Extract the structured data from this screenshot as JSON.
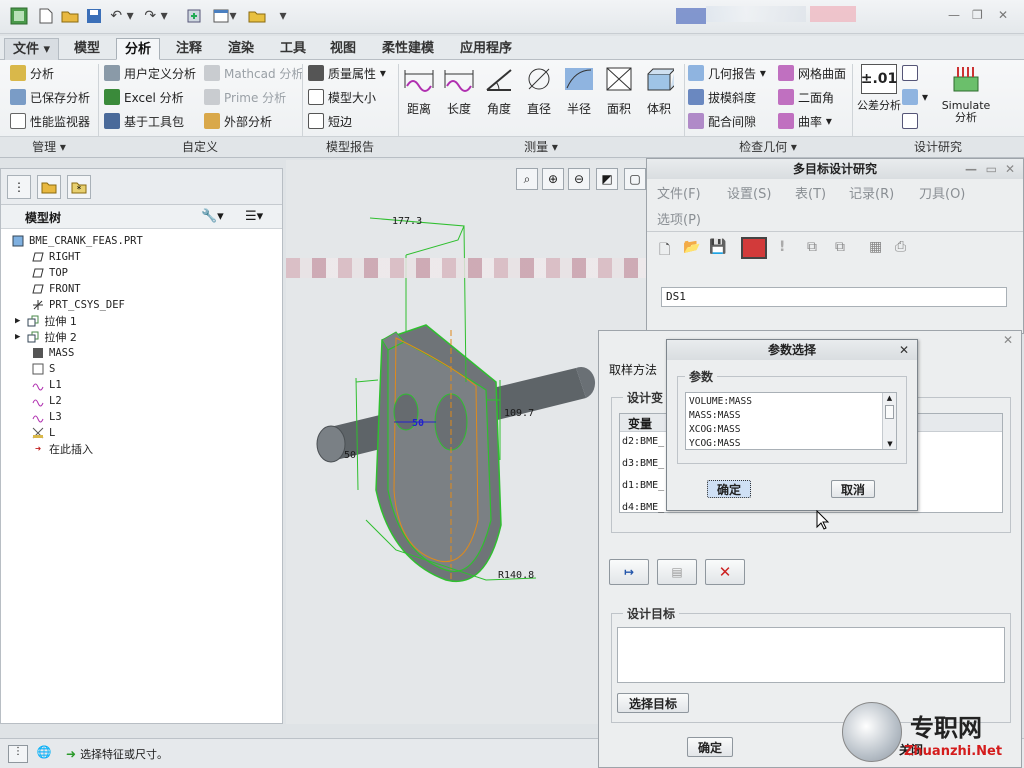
{
  "ribbon_tabs": {
    "file": "文件",
    "items": [
      "模型",
      "分析",
      "注释",
      "渲染",
      "工具",
      "视图",
      "柔性建模",
      "应用程序"
    ],
    "active": "分析"
  },
  "ribbon": {
    "manage": {
      "label": "管理",
      "items": [
        "分析",
        "已保存分析",
        "性能监视器"
      ]
    },
    "custom": {
      "label": "自定义",
      "items": [
        "用户定义分析",
        "Excel 分析",
        "基于工具包",
        "Mathcad 分析",
        "Prime 分析",
        "外部分析"
      ]
    },
    "model_report": {
      "label": "模型报告",
      "items": [
        "质量属性",
        "模型大小",
        "短边"
      ]
    },
    "measure": {
      "label": "测量",
      "items": [
        "距离",
        "长度",
        "角度",
        "直径",
        "半径",
        "面积",
        "体积"
      ]
    },
    "inspect": {
      "label": "检查几何",
      "items": [
        "几何报告",
        "拔模斜度",
        "配合间隙",
        "网格曲面",
        "二面角",
        "曲率"
      ]
    },
    "design_study": {
      "label": "设计研究",
      "items": [
        "公差分析",
        "Simulate 分析"
      ],
      "tol_value": "±.01"
    }
  },
  "model_tree": {
    "title": "模型树",
    "items": [
      {
        "label": "BME_CRANK_FEAS.PRT",
        "icon": "part-icon"
      },
      {
        "label": "RIGHT",
        "icon": "datum-plane-icon"
      },
      {
        "label": "TOP",
        "icon": "datum-plane-icon"
      },
      {
        "label": "FRONT",
        "icon": "datum-plane-icon"
      },
      {
        "label": "PRT_CSYS_DEF",
        "icon": "csys-icon"
      },
      {
        "label": "拉伸 1",
        "icon": "extrude-icon"
      },
      {
        "label": "拉伸 2",
        "icon": "extrude-icon"
      },
      {
        "label": "MASS",
        "icon": "analysis-icon"
      },
      {
        "label": "S",
        "icon": "analysis-icon"
      },
      {
        "label": "L1",
        "icon": "measure-icon"
      },
      {
        "label": "L2",
        "icon": "measure-icon"
      },
      {
        "label": "L3",
        "icon": "measure-icon"
      },
      {
        "label": "L",
        "icon": "analysis-icon"
      },
      {
        "label": "在此插入",
        "icon": "insert-arrow-icon"
      }
    ]
  },
  "dimensions": {
    "d1": "177.3",
    "d2": "50",
    "d3": "109.7",
    "d4": "R140.8",
    "d5": "50"
  },
  "status": {
    "message": "选择特征或尺寸。"
  },
  "mo_dialog": {
    "title": "多目标设计研究",
    "menus": [
      "文件(F)",
      "设置(S)",
      "表(T)",
      "记录(R)",
      "刀具(O)",
      "选项(P)"
    ],
    "study_name": "DS1"
  },
  "sampling_dialog": {
    "method_label": "取样方法",
    "design_vars_label": "设计变",
    "col_var": "变量",
    "rows": [
      "d2:BME_",
      "d3:BME_",
      "d1:BME_",
      "d4:BME_"
    ],
    "design_goal_label": "设计目标",
    "select_goal_btn": "选择目标",
    "ok_btn": "确定",
    "partial_label": "关闭"
  },
  "param_dialog": {
    "title": "参数选择",
    "group_label": "参数",
    "options": [
      "VOLUME:MASS",
      "MASS:MASS",
      "XCOG:MASS",
      "YCOG:MASS"
    ],
    "ok": "确定",
    "cancel": "取消"
  },
  "watermark": {
    "text": "专职网",
    "url": "Zhuanzhi.Net"
  },
  "colors": {
    "accent_green": "#2fbf2f",
    "orange": "#e08a1a",
    "selection_blue": "#cfe0f5",
    "part_gray": "#6f7478"
  }
}
